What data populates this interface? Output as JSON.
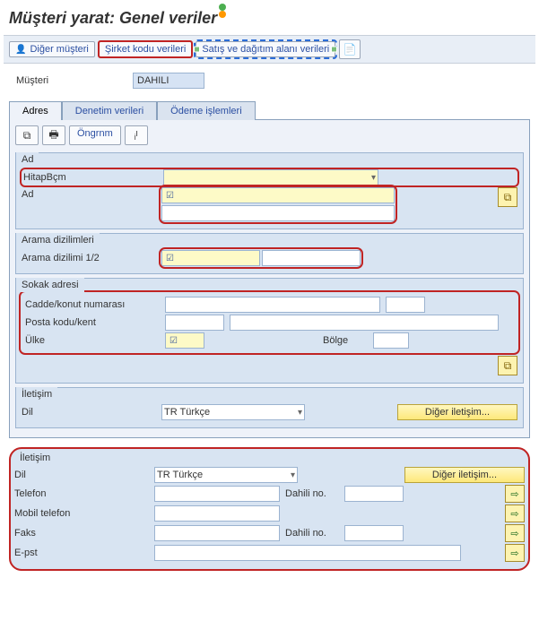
{
  "title": "Müşteri yarat: Genel veriler",
  "toolbar": {
    "other_customer": "Diğer müşteri",
    "company_code": "Şirket kodu verileri",
    "sales_area": "Satış ve dağıtım alanı verileri"
  },
  "client": {
    "label": "Müşteri",
    "value": "DAHILI"
  },
  "tabs": {
    "address": "Adres",
    "control": "Denetim verileri",
    "payment": "Ödeme işlemleri"
  },
  "subtoolbar": {
    "preview": "Öngrnm"
  },
  "groups": {
    "name": {
      "title": "Ad",
      "salutation": "HitapBçm",
      "name_label": "Ad"
    },
    "search": {
      "title": "Arama dizilimleri",
      "search_label": "Arama dizilimi 1/2"
    },
    "street": {
      "title": "Sokak adresi",
      "street_label": "Cadde/konut numarası",
      "postal_label": "Posta kodu/kent",
      "country_label": "Ülke",
      "region_label": "Bölge"
    },
    "comm1": {
      "title": "İletişim",
      "lang_label": "Dil",
      "lang_value": "TR Türkçe",
      "other_comm": "Diğer iletişim..."
    },
    "comm2": {
      "title": "İletişim",
      "lang_label": "Dil",
      "lang_value": "TR Türkçe",
      "other_comm": "Diğer iletişim...",
      "phone_label": "Telefon",
      "ext_label": "Dahili no.",
      "mobile_label": "Mobil telefon",
      "fax_label": "Faks",
      "email_label": "E-pst"
    }
  }
}
